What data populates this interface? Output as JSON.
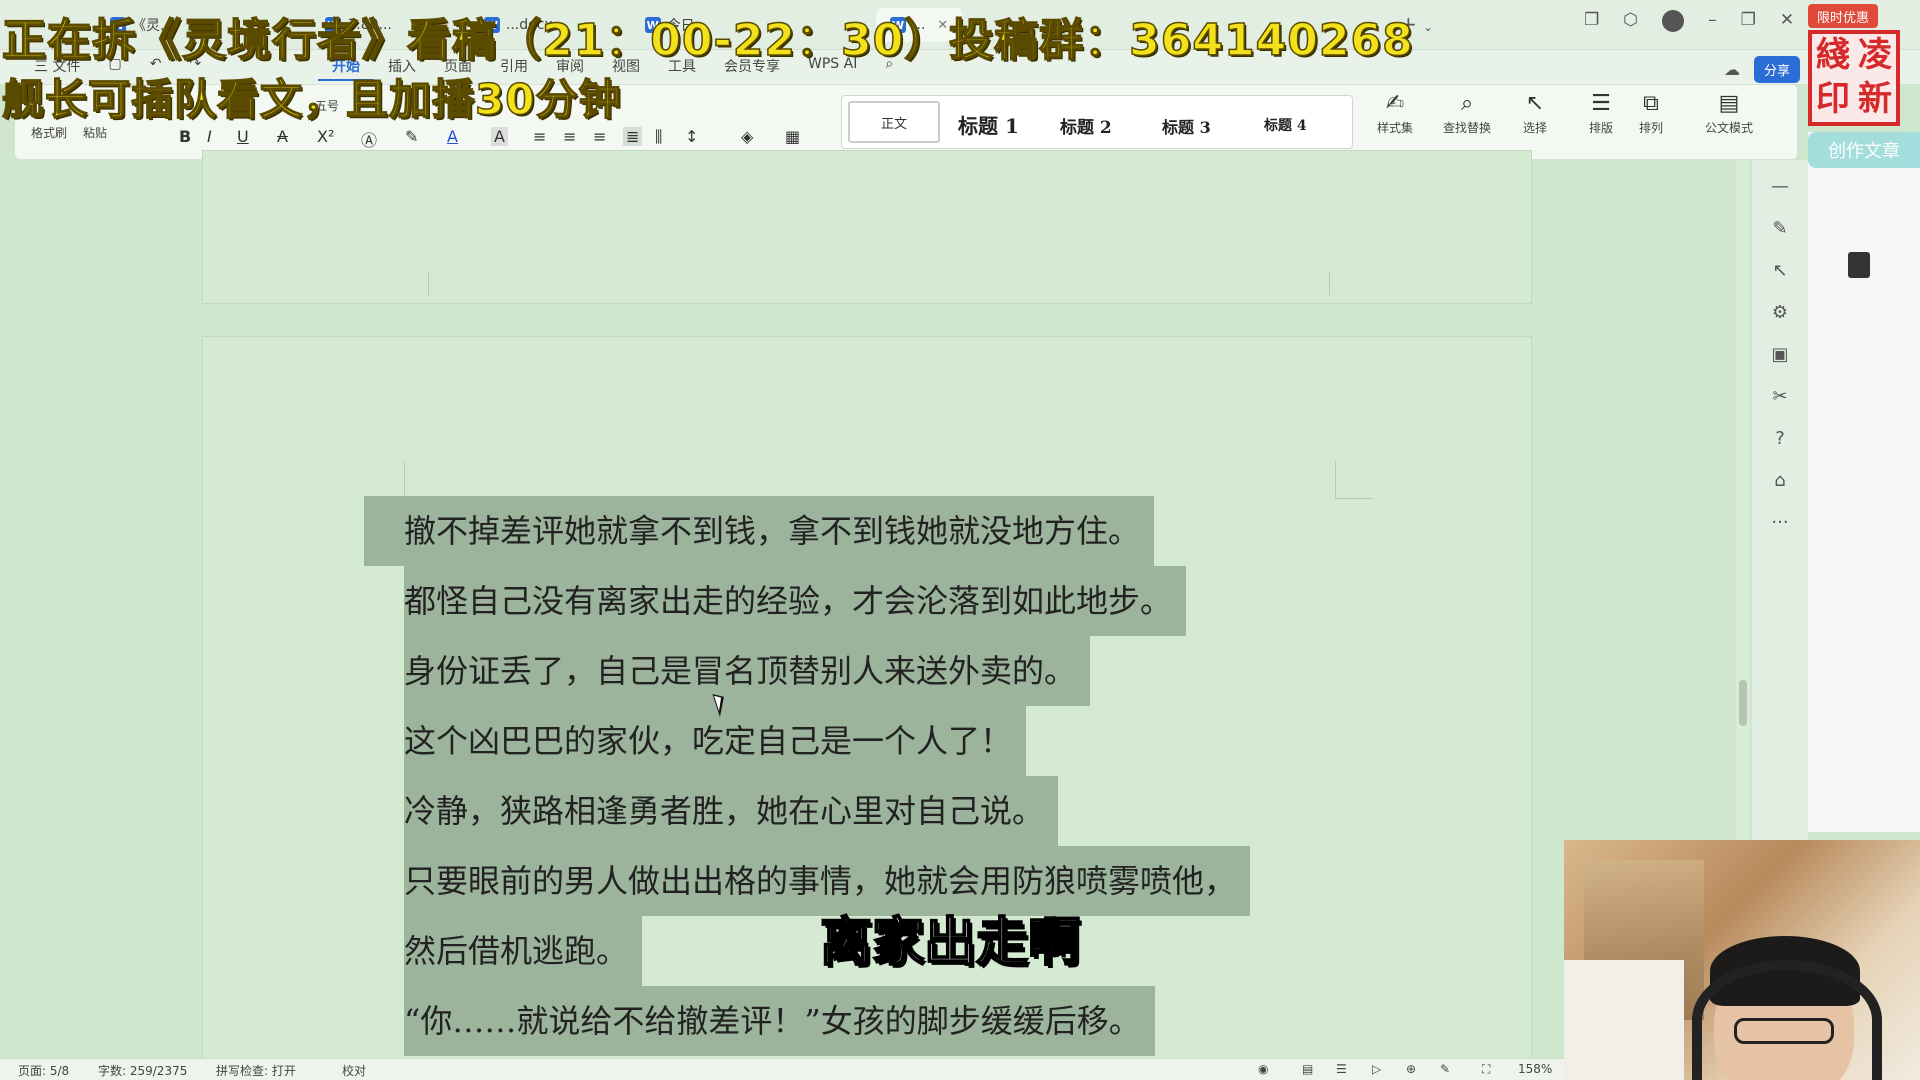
{
  "window": {
    "tabs": [
      {
        "label": "《灵...",
        "icon": "wps-doc-icon"
      },
      {
        "label": "1.80...",
        "icon": "word-doc-icon"
      },
      {
        "label": "...docx",
        "icon": "word-doc-icon"
      },
      {
        "label": "今日...",
        "icon": "word-doc-icon"
      },
      {
        "label": "...",
        "icon": "word-doc-icon"
      }
    ],
    "new_tab": "+"
  },
  "menu": {
    "file": "三 文件",
    "items": [
      "开始",
      "插入",
      "页面",
      "引用",
      "审阅",
      "视图",
      "工具",
      "会员专享"
    ],
    "active": "开始",
    "wps_ai": "WPS AI",
    "share": "分享"
  },
  "ribbon": {
    "format_painter": "格式刷",
    "paste": "粘贴",
    "font_size_label": "五号",
    "styles": {
      "normal": "正文",
      "h1": "标题 1",
      "h2": "标题 2",
      "h3": "标题 3",
      "h4": "标题 4"
    },
    "style_set": "样式集",
    "find_replace": "查找替换",
    "select": "选择",
    "layout": "排版",
    "arrange": "排列",
    "official_mode": "公文模式"
  },
  "document": {
    "lines": [
      "撤不掉差评她就拿不到钱，拿不到钱她就没地方住。",
      "都怪自己没有离家出走的经验，才会沦落到如此地步。",
      "身份证丢了，自己是冒名顶替别人来送外卖的。",
      "这个凶巴巴的家伙，吃定自己是一个人了！",
      "冷静，狭路相逢勇者胜，她在心里对自己说。",
      "只要眼前的男人做出出格的事情，她就会用防狼喷雾喷他，",
      "然后借机逃跑。",
      "“你……就说给不给撤差评！”女孩的脚步缓缓后移。"
    ]
  },
  "side_panel": {
    "create_article": "创作文章",
    "promo": "限时优惠"
  },
  "statusbar": {
    "page": "页面: 5/8",
    "word_count": "字数: 259/2375",
    "spell_check": "拼写检查: 打开",
    "proofread": "校对",
    "zoom": "158%"
  },
  "overlay": {
    "line1": "正在拆《灵境行者》看稿（21：00-22：30）投稿群：364140268",
    "line2": "舰长可插队看文，且加播30分钟",
    "subtitle": "离家出走啊",
    "seal_chars": [
      "凌",
      "綫",
      "新",
      "印"
    ]
  },
  "colors": {
    "doc_bg": "#cfe8cd",
    "selection": "#9cb49b",
    "accent": "#2b6cd6",
    "overlay_text": "#f3e21b",
    "seal": "#d62a2a"
  }
}
